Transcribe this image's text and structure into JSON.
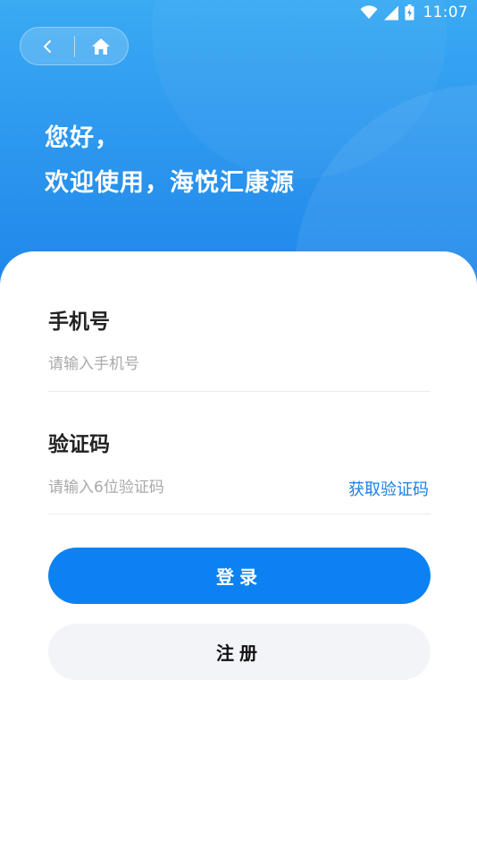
{
  "status_bar": {
    "time": "11:07",
    "icons": [
      "wifi-icon",
      "signal-icon",
      "battery-icon"
    ]
  },
  "nav": {
    "back_icon": "chevron-left-icon",
    "home_icon": "home-icon"
  },
  "header": {
    "greeting_line1": "您好，",
    "greeting_line2": "欢迎使用，海悦汇康源"
  },
  "form": {
    "phone_label": "手机号",
    "phone_placeholder": "请输入手机号",
    "code_label": "验证码",
    "code_placeholder": "请输入6位验证码",
    "get_code": "获取验证码"
  },
  "buttons": {
    "login": "登录",
    "register": "注册"
  },
  "colors": {
    "header_gradient_top": "#3aaaf3",
    "header_gradient_bottom": "#1f86ea",
    "accent": "#0c82f2",
    "link": "#1a7fe6",
    "register_bg": "#f3f4f8"
  }
}
